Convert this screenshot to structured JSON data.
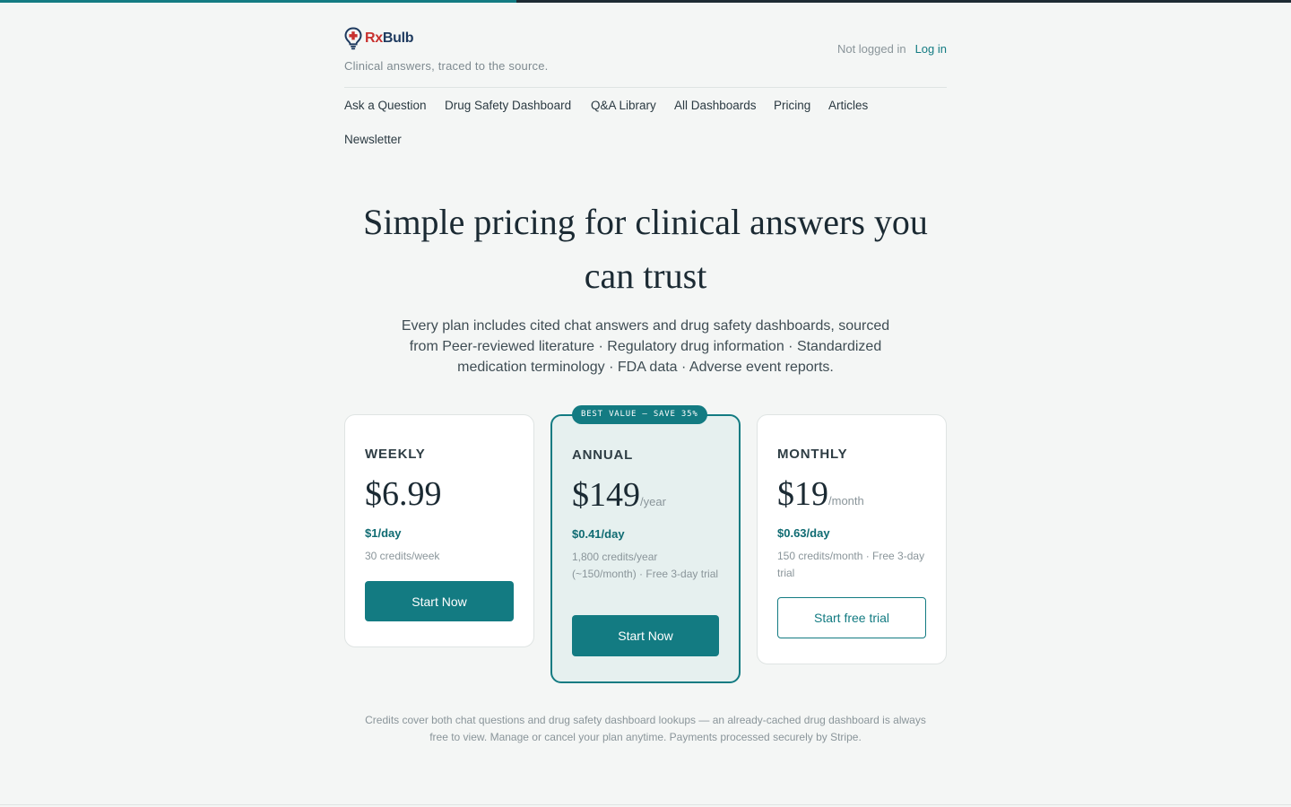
{
  "page": {
    "progress_fraction": 0.4,
    "progress_color": "#137b82"
  },
  "brand": {
    "name_part1": "Rx",
    "name_part2": "Bulb",
    "tagline": "Clinical answers, traced to the source.",
    "icon": "lightbulb-cross-icon"
  },
  "auth": {
    "status": "Not logged in",
    "login_label": "Log in"
  },
  "nav": {
    "items": [
      "Ask a Question",
      "Drug Safety Dashboard",
      "Q&A Library",
      "All Dashboards",
      "Pricing",
      "Articles",
      "Newsletter"
    ]
  },
  "hero": {
    "title": "Simple pricing for clinical answers you can trust",
    "subtitle": "Every plan includes cited chat answers and drug safety dashboards, sourced from Peer-reviewed literature · Regulatory drug information · Standardized medication terminology · FDA data · Adverse event reports."
  },
  "plans": [
    {
      "name": "WEEKLY",
      "price": "$6.99",
      "period": "",
      "per_day": "$1/day",
      "details": "30 credits/week",
      "cta": "Start Now",
      "style": "solid"
    },
    {
      "name": "ANNUAL",
      "badge": "BEST VALUE — SAVE 35%",
      "price": "$149",
      "period": "/year",
      "per_day": "$0.41/day",
      "details": "1,800 credits/year (~150/month) · Free 3-day trial",
      "cta": "Start Now",
      "style": "solid",
      "featured": true
    },
    {
      "name": "MONTHLY",
      "price": "$19",
      "period": "/month",
      "per_day": "$0.63/day",
      "details": "150 credits/month · Free 3-day trial",
      "cta": "Start free trial",
      "style": "outline"
    }
  ],
  "footnote": "Credits cover both chat questions and drug safety dashboard lookups — an already-cached drug dashboard is always free to view. Manage or cancel your plan anytime. Payments processed securely by Stripe.",
  "colors": {
    "accent": "#137b82",
    "brand_red": "#c8312f",
    "brand_navy": "#1e3a5f",
    "background": "#f4f6f5"
  }
}
